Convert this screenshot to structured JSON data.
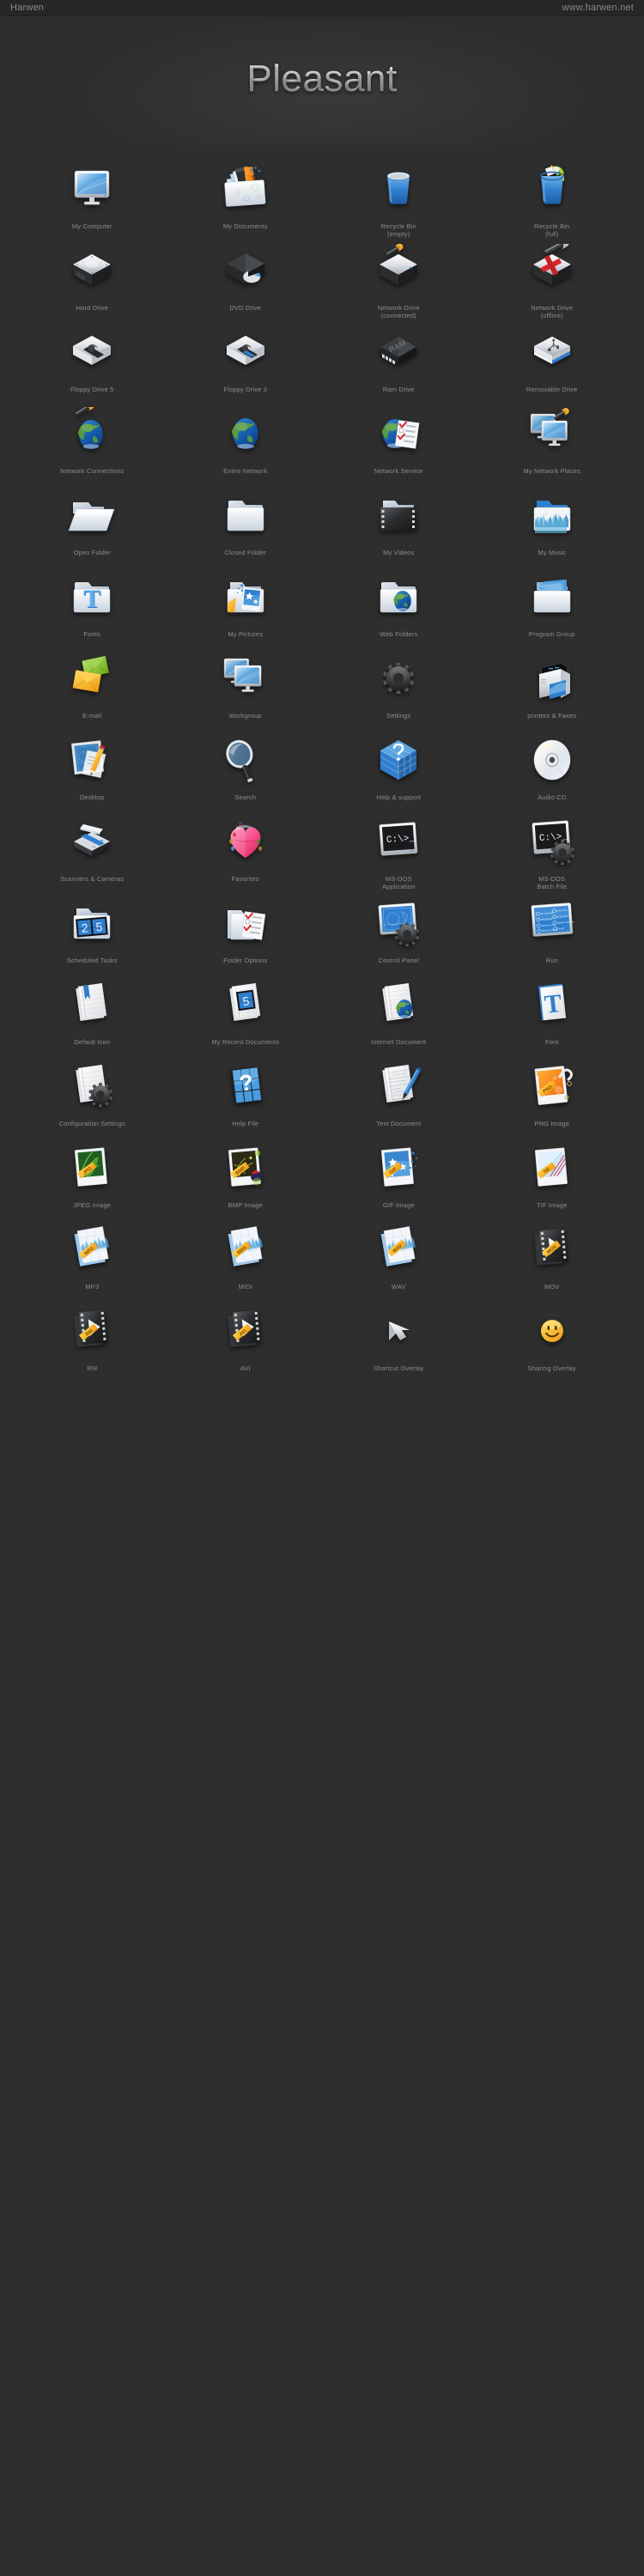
{
  "topbar": {
    "brand": "Harwen",
    "site": "www.harwen.net"
  },
  "hero": {
    "title": "Pleasant"
  },
  "palette": {
    "background": "#2e2e2e",
    "topbar_background": "#262626",
    "caption_color": "#8d8d8d",
    "title_highlight": "#ffffff",
    "accent_blue": "#3a8ad6",
    "accent_yellow": "#f5b820",
    "accent_orange": "#f08519",
    "accent_green": "#8cc63f",
    "accent_red": "#d9262b",
    "accent_pink": "#f5548a",
    "dark_metal": "#343434",
    "light_metal": "#e9edf1"
  },
  "icons": [
    {
      "label": "My Computer",
      "glyph": "monitor"
    },
    {
      "label": "My Documents",
      "glyph": "folder-documents"
    },
    {
      "label": "Recycle Bin\n(empty)",
      "glyph": "bin-empty"
    },
    {
      "label": "Recycle Bin\n(full)",
      "glyph": "bin-full"
    },
    {
      "label": "Hard Drive",
      "glyph": "hard-drive"
    },
    {
      "label": "DVD Drive",
      "glyph": "dvd-drive"
    },
    {
      "label": "Network Drive\n(connected)",
      "glyph": "net-drive-on"
    },
    {
      "label": "Network Drive\n(offline)",
      "glyph": "net-drive-off"
    },
    {
      "label": "Floppy Drive 5",
      "glyph": "floppy5"
    },
    {
      "label": "Floppy Drive 3",
      "glyph": "floppy3"
    },
    {
      "label": "Ram Drive",
      "glyph": "ram-chip"
    },
    {
      "label": "Removable Drive",
      "glyph": "usb-drive"
    },
    {
      "label": "Network Connections",
      "glyph": "globe-wrench"
    },
    {
      "label": "Entire Network",
      "glyph": "globe"
    },
    {
      "label": "Network Service",
      "glyph": "globe-list"
    },
    {
      "label": "My Network Places",
      "glyph": "monitors-wrench"
    },
    {
      "label": "Open Folder",
      "glyph": "folder-open"
    },
    {
      "label": "Closed Folder",
      "glyph": "folder-closed"
    },
    {
      "label": "My Videos",
      "glyph": "folder-video"
    },
    {
      "label": "My Music",
      "glyph": "folder-music"
    },
    {
      "label": "Fonts",
      "glyph": "folder-font"
    },
    {
      "label": "My Pictures",
      "glyph": "folder-pictures"
    },
    {
      "label": "Web Folders",
      "glyph": "folder-web"
    },
    {
      "label": "Program Group",
      "glyph": "folder-group"
    },
    {
      "label": "E-mail",
      "glyph": "envelopes"
    },
    {
      "label": "Workgroup",
      "glyph": "two-monitors"
    },
    {
      "label": "Settings",
      "glyph": "gear"
    },
    {
      "label": "printers & Faxes",
      "glyph": "printer"
    },
    {
      "label": "Desktop",
      "glyph": "desktop-pencil"
    },
    {
      "label": "Search",
      "glyph": "magnifier"
    },
    {
      "label": "Help & support",
      "glyph": "help-cube"
    },
    {
      "label": "Audio CD",
      "glyph": "cd"
    },
    {
      "label": "Scanners & Cameras",
      "glyph": "scanner"
    },
    {
      "label": "Favorites",
      "glyph": "heart"
    },
    {
      "label": "MS-DOS\nApplication",
      "glyph": "dos-screen"
    },
    {
      "label": "MS-DOS\nBatch File",
      "glyph": "dos-gear"
    },
    {
      "label": "Scheduled Tasks",
      "glyph": "folder-clock"
    },
    {
      "label": "Folder Options",
      "glyph": "folder-checklist"
    },
    {
      "label": "Control Panel",
      "glyph": "panel-gear"
    },
    {
      "label": "Run",
      "glyph": "run-dialog"
    },
    {
      "label": "Default Icon",
      "glyph": "doc-bookmark"
    },
    {
      "label": "My Recent Documents",
      "glyph": "doc-clock"
    },
    {
      "label": "Internet Document",
      "glyph": "doc-globe"
    },
    {
      "label": "Font",
      "glyph": "doc-font"
    },
    {
      "label": "Configuration Settings",
      "glyph": "doc-gear"
    },
    {
      "label": "Help File",
      "glyph": "help-tiles"
    },
    {
      "label": "Text Document",
      "glyph": "doc-pen"
    },
    {
      "label": "PNG Image",
      "glyph": "img-png"
    },
    {
      "label": "JPEG Image",
      "glyph": "img-jpg"
    },
    {
      "label": "BMP Image",
      "glyph": "img-bmp"
    },
    {
      "label": "GIF Image",
      "glyph": "img-gif"
    },
    {
      "label": "TIF Image",
      "glyph": "img-tif"
    },
    {
      "label": "MP3",
      "glyph": "audio-mp3"
    },
    {
      "label": "MIDI",
      "glyph": "audio-midi"
    },
    {
      "label": "WAV",
      "glyph": "audio-wav"
    },
    {
      "label": "MOV",
      "glyph": "video-mov"
    },
    {
      "label": "RM",
      "glyph": "video-rm"
    },
    {
      "label": "AVI",
      "glyph": "video-avi"
    },
    {
      "label": "Shortcut Overlay",
      "glyph": "shortcut-arrow"
    },
    {
      "label": "Sharing Overlay",
      "glyph": "smiley"
    }
  ],
  "ribbon_labels": {
    "png": "PNG",
    "jpg": "JPG",
    "bmp": "BMP",
    "gif": "GIF",
    "tif": "TIF",
    "mp3": "MP3",
    "midi": "MIDI",
    "wav": "WAV",
    "mov": "MOV",
    "rm": "RM",
    "avi": "AVI"
  },
  "icon_inner_text": {
    "ram_chip": "RAM",
    "dos_prompt": "C:\\>_",
    "scheduled_tasks_number": "25",
    "recent_documents_number": "5",
    "font_letter": "T",
    "help_mark": "?"
  }
}
